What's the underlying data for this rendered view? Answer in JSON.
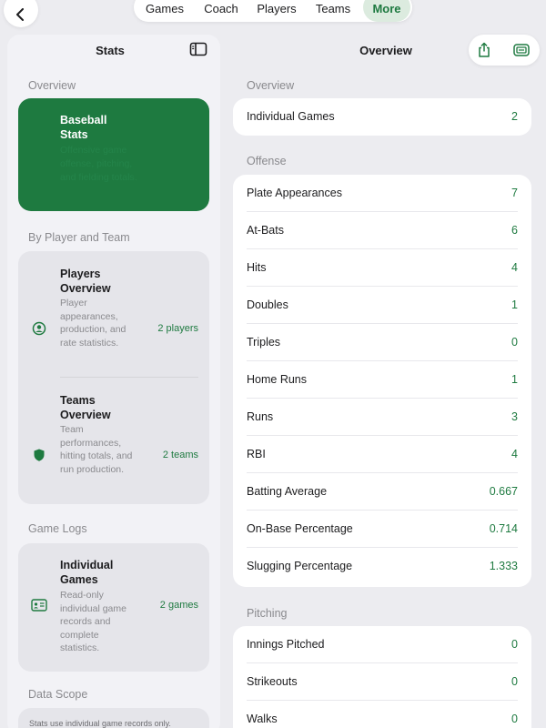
{
  "colors": {
    "accent": "#1e7a40",
    "accent_light": "#dcebdf",
    "background": "#ececf0"
  },
  "nav": {
    "back_icon": "chevron-left-icon",
    "tabs": [
      {
        "label": "Games",
        "active": false
      },
      {
        "label": "Coach",
        "active": false
      },
      {
        "label": "Players",
        "active": false
      },
      {
        "label": "Teams",
        "active": false
      },
      {
        "label": "More",
        "active": true
      }
    ]
  },
  "sidebar": {
    "title": "Stats",
    "toggle_icon": "sidebar-toggle-icon",
    "sections": {
      "overview": "Overview",
      "by_player_team": "By Player and Team",
      "game_logs": "Game Logs",
      "data_scope": "Data Scope"
    },
    "hero": {
      "title": "Baseball Stats",
      "description": "Offensive game offense, pitching, and fielding totals."
    },
    "players": {
      "title": "Players Overview",
      "description": "Player appearances, production, and rate statistics.",
      "count": "2 players",
      "icon": "person-circle-icon"
    },
    "teams": {
      "title": "Teams Overview",
      "description": "Team performances, hitting totals, and run production.",
      "count": "2 teams",
      "icon": "shield-icon"
    },
    "games": {
      "title": "Individual Games",
      "description": "Read-only individual game records and complete statistics.",
      "count": "2 games",
      "icon": "id-card-icon"
    },
    "scope_text": "Stats use individual game records only."
  },
  "main": {
    "title": "Overview",
    "action_icons": [
      "share-icon",
      "archive-icon"
    ],
    "sections": {
      "overview": "Overview",
      "offense": "Offense",
      "pitching": "Pitching"
    },
    "overview_rows": [
      {
        "label": "Individual Games",
        "value": "2"
      }
    ],
    "offense_rows": [
      {
        "label": "Plate Appearances",
        "value": "7"
      },
      {
        "label": "At-Bats",
        "value": "6"
      },
      {
        "label": "Hits",
        "value": "4"
      },
      {
        "label": "Doubles",
        "value": "1"
      },
      {
        "label": "Triples",
        "value": "0"
      },
      {
        "label": "Home Runs",
        "value": "1"
      },
      {
        "label": "Runs",
        "value": "3"
      },
      {
        "label": "RBI",
        "value": "4"
      },
      {
        "label": "Batting Average",
        "value": "0.667"
      },
      {
        "label": "On-Base Percentage",
        "value": "0.714"
      },
      {
        "label": "Slugging Percentage",
        "value": "1.333"
      }
    ],
    "pitching_rows": [
      {
        "label": "Innings Pitched",
        "value": "0"
      },
      {
        "label": "Strikeouts",
        "value": "0"
      },
      {
        "label": "Walks",
        "value": "0"
      }
    ]
  }
}
